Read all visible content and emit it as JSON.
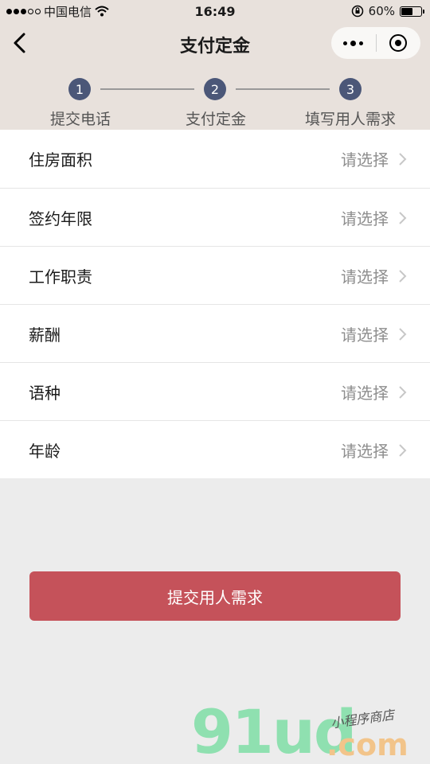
{
  "status_bar": {
    "carrier": "中国电信",
    "time": "16:49",
    "battery_percent": "60%",
    "battery_level": 0.6
  },
  "nav": {
    "title": "支付定金"
  },
  "steps": [
    {
      "number": "1",
      "label": "提交电话"
    },
    {
      "number": "2",
      "label": "支付定金"
    },
    {
      "number": "3",
      "label": "填写用人需求"
    }
  ],
  "form": {
    "rows": [
      {
        "label": "住房面积",
        "value": "请选择"
      },
      {
        "label": "签约年限",
        "value": "请选择"
      },
      {
        "label": "工作职责",
        "value": "请选择"
      },
      {
        "label": "薪酬",
        "value": "请选择"
      },
      {
        "label": "语种",
        "value": "请选择"
      },
      {
        "label": "年龄",
        "value": "请选择"
      }
    ]
  },
  "submit": {
    "label": "提交用人需求"
  },
  "watermark": {
    "brand": "91ud",
    "domain": ".com",
    "tagline": "小程序商店"
  },
  "colors": {
    "header_bg": "#e8e1dc",
    "step_circle": "#4b5778",
    "submit_button": "#c5525a",
    "page_bg": "#ececec"
  }
}
